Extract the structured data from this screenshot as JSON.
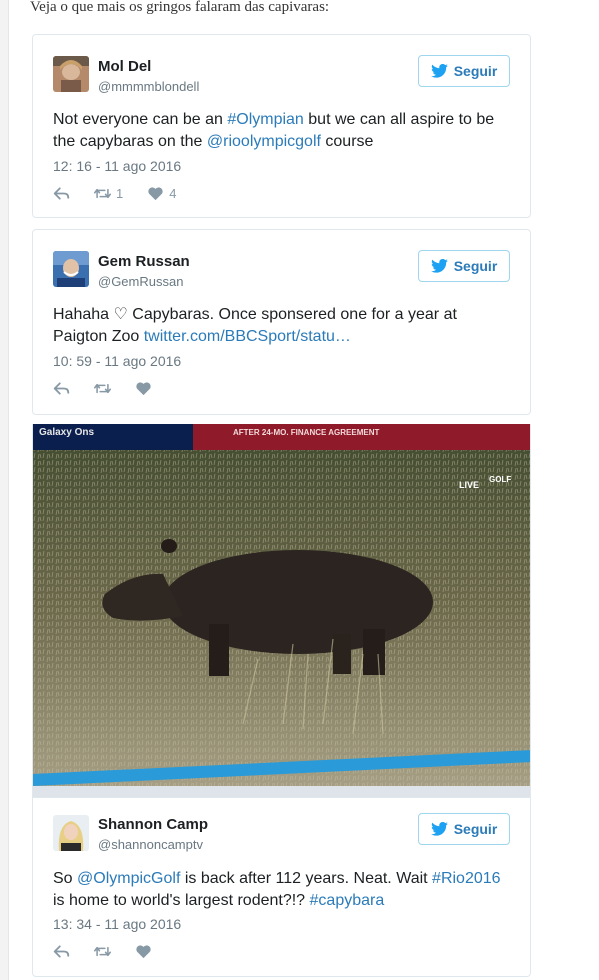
{
  "intro": "Veja o que mais os gringos falaram das capivaras:",
  "tweets": [
    {
      "name": "Mol Del",
      "handle": "@mmmmblondell",
      "follow_label": "Seguir",
      "text_parts": [
        "Not everyone can be an ",
        "#Olympian",
        " but we can all aspire to be the capybaras on the ",
        "@rioolympicgolf",
        " course"
      ],
      "time": "12: 16 - 11 ago 2016",
      "retweets": "1",
      "likes": "4"
    },
    {
      "name": "Gem Russan",
      "handle": "@GemRussan",
      "follow_label": "Seguir",
      "text_parts": [
        "Hahaha ♡ Capybaras. Once sponsered one for a year at Paigton Zoo ",
        "twitter.com/BBCSport/statu…"
      ],
      "time": "10: 59 - 11 ago 2016"
    },
    {
      "name": "Shannon Camp",
      "handle": "@shannoncamptv",
      "follow_label": "Seguir",
      "text_parts": [
        "So ",
        "@OlympicGolf",
        " is back after 112 years. Neat. Wait ",
        "#Rio2016",
        " is home to world's largest rodent?!? ",
        "#capybara"
      ],
      "time": "13: 34 - 11 ago 2016"
    }
  ],
  "photo": {
    "banner_left": "Galaxy Ons",
    "banner_center": "AFTER 24-MO. FINANCE AGREEMENT",
    "live": "LIVE",
    "network": "GOLF"
  },
  "colors": {
    "link": "#2b7bb9",
    "follow_border": "#9fd6ee",
    "muted": "#697882"
  },
  "icons": {
    "follow": "twitter-bird-icon",
    "reply": "reply-icon",
    "retweet": "retweet-icon",
    "like": "heart-icon"
  }
}
